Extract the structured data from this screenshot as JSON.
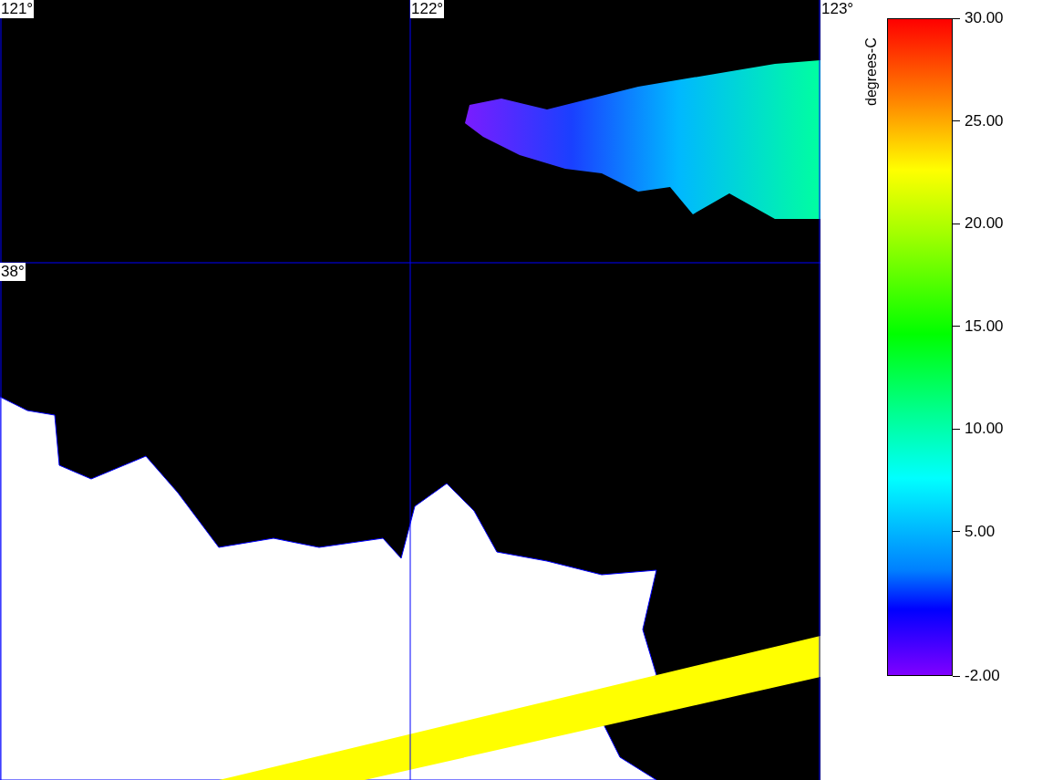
{
  "map": {
    "lon_labels": [
      "121°",
      "122°",
      "123°"
    ],
    "lat_labels": [
      "38°"
    ]
  },
  "colorbar": {
    "unit": "degrees-C",
    "tick_labels": [
      "30.00",
      "25.00",
      "20.00",
      "15.00",
      "10.00",
      "5.00",
      "-2.00"
    ]
  }
}
